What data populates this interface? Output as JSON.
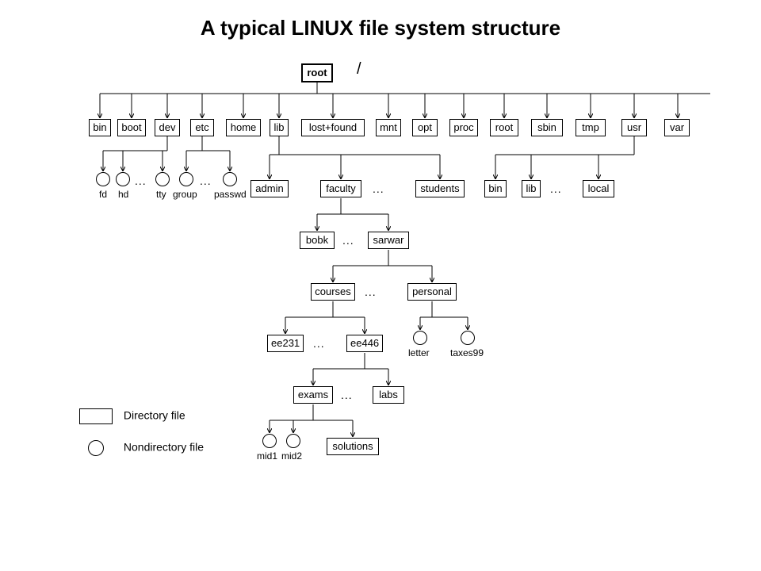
{
  "title": "A typical LINUX file system structure",
  "root_label": "root",
  "slash": "/",
  "level1": [
    "bin",
    "boot",
    "dev",
    "etc",
    "home",
    "lib",
    "lost+found",
    "mnt",
    "opt",
    "proc",
    "root",
    "sbin",
    "tmp",
    "usr",
    "var"
  ],
  "dev_files": [
    "fd",
    "hd",
    "tty"
  ],
  "etc_files": [
    "group",
    "passwd"
  ],
  "home_dirs": [
    "admin",
    "faculty",
    "students"
  ],
  "usr_dirs": [
    "bin",
    "lib",
    "local"
  ],
  "faculty_dirs": [
    "bobk",
    "sarwar"
  ],
  "sarwar_dirs": [
    "courses",
    "personal"
  ],
  "personal_files": [
    "letter",
    "taxes99"
  ],
  "courses_dirs": [
    "ee231",
    "ee446"
  ],
  "ee446_dirs": [
    "exams",
    "labs"
  ],
  "exams_files": [
    "mid1",
    "mid2"
  ],
  "exams_dirs": [
    "solutions"
  ],
  "legend": {
    "dir": "Directory file",
    "file": "Nondirectory file"
  },
  "ellipsis": "..."
}
